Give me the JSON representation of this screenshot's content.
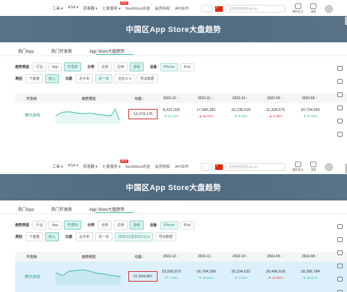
{
  "nav": [
    "· 工具 ▾",
    "ASA ▾",
    "获客翻 ▾",
    "七麦服务 ▾",
    "NextWord评选",
    "会员特权",
    "API合作"
  ],
  "nav_hot": "NEW",
  "search_placeholder": "应用名称或者App ID",
  "my_follow": "我的关注",
  "messages": "消息",
  "page_title": "中国区App Store大盘趋势",
  "tabs": [
    "热门App",
    "热门开发商",
    "App Store大盘趋势"
  ],
  "filters": {
    "type_label": "趋势类型",
    "type_opts": [
      "行业",
      "App",
      "开发商"
    ],
    "cat_label": "分类",
    "cat_opts": [
      "全部",
      "应用",
      "游戏"
    ],
    "dev_label": "设备",
    "dev_opts": [
      "iPhone",
      "iPad"
    ],
    "metric_label": "类别",
    "metric_opts": [
      "下载量",
      "收入"
    ],
    "date_label": "日期",
    "date_opts": [
      "近半年",
      "近一年"
    ],
    "date_custom_1": "自定义 ▾",
    "date_custom_2": "2022-01至2022-12 ▾",
    "export": "导出数据"
  },
  "table_head": {
    "dev": "开发商",
    "trend": "趋势预览",
    "total": "均值 ↓"
  },
  "months": [
    "2022-12 ↕",
    "2022-11 ↕",
    "2022-10 ↕",
    "2022-09 ↕",
    "2022-08 ↕"
  ],
  "row1": {
    "name": "腾讯游戏",
    "total": "12,274,176",
    "vals": [
      "8,222,926",
      "17,086,381",
      "10,236,918",
      "11,309,575",
      "10,734,695"
    ],
    "deltas": [
      "▼ 51.87%",
      "▲ 66.91%",
      "▼ 9.49%",
      "▲ 5.36%",
      "▼ 11.54%"
    ],
    "dirs": [
      "up",
      "down",
      "up",
      "down",
      "up"
    ]
  },
  "row2": {
    "name": "腾讯游戏",
    "total": "21,504,467",
    "vals": [
      "15,500,870",
      "16,704,299",
      "20,104,632",
      "20,496,918",
      "18,286,784"
    ],
    "deltas": [
      "▼ 7.20%",
      "▼ 16.91%",
      "▼ 1.91%",
      "▼ 12.09%",
      "▼ 30.07%"
    ],
    "dirs": [
      "up",
      "up",
      "up",
      "down",
      "up"
    ]
  },
  "colors": {
    "accent": "#2eb8a6",
    "banner": "#536d83",
    "highlight_box": "#d7272b"
  }
}
